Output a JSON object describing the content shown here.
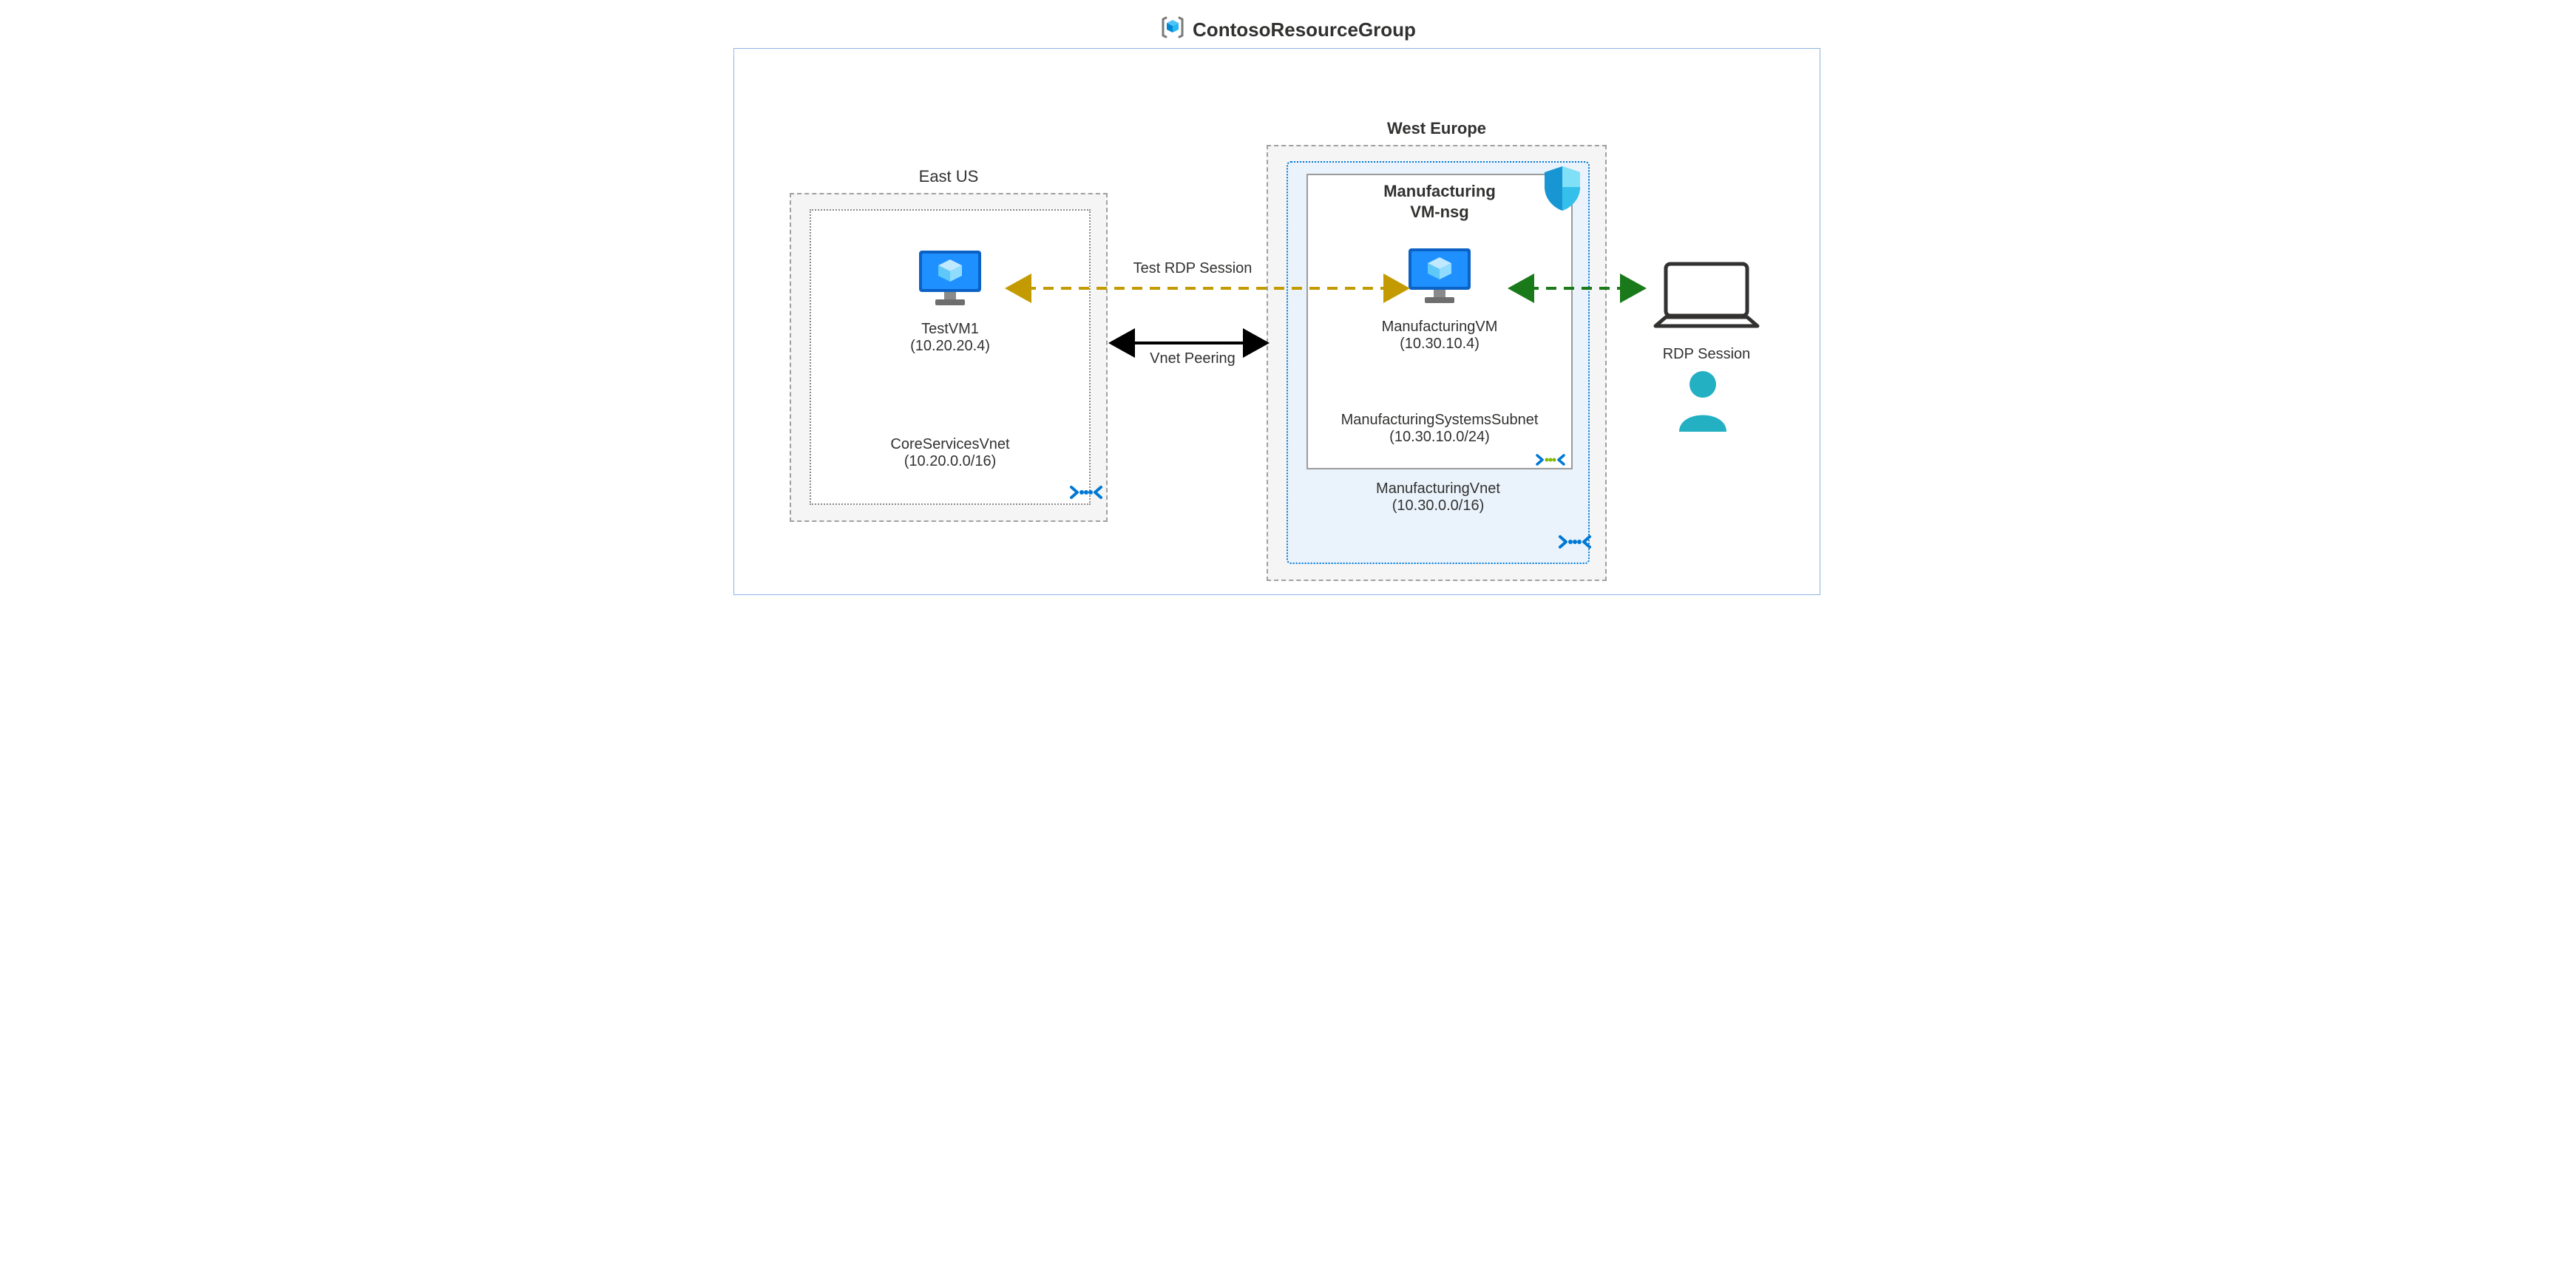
{
  "resourceGroup": {
    "name": "ContosoResourceGroup"
  },
  "regions": {
    "east": {
      "title": "East US"
    },
    "west": {
      "title": "West Europe"
    }
  },
  "eastVm": {
    "name": "TestVM1",
    "ip": "(10.20.20.4)"
  },
  "coreVnet": {
    "name": "CoreServicesVnet",
    "cidr": "(10.20.0.0/16)"
  },
  "nsg": {
    "line1": "Manufacturing",
    "line2": "VM-nsg"
  },
  "westVm": {
    "name": "ManufacturingVM",
    "ip": "(10.30.10.4)"
  },
  "subnet": {
    "name": "ManufacturingSystemsSubnet",
    "cidr": "(10.30.10.0/24)"
  },
  "mfgVnet": {
    "name": "ManufacturingVnet",
    "cidr": "(10.30.0.0/16)"
  },
  "connections": {
    "testRdp": "Test RDP Session",
    "peering": "Vnet Peering",
    "rdp": "RDP Session"
  },
  "colors": {
    "azureBlue": "#0078d4",
    "peeringArrow": "#000000",
    "testRdpArrow": "#c39b00",
    "rdpArrow": "#1a7a1a",
    "teal": "#23b0c3"
  }
}
